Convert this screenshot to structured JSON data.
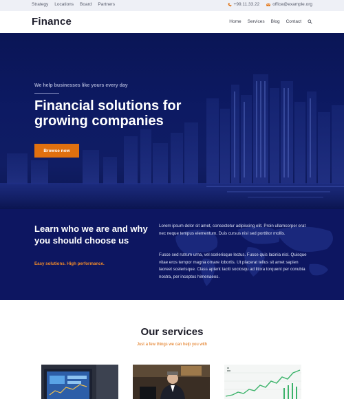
{
  "topbar": {
    "links": [
      "Strategy",
      "Locations",
      "Board",
      "Partners"
    ],
    "phone": "+99.11.33.22",
    "email": "office@example.org",
    "phone_icon": "phone-icon",
    "email_icon": "envelope-icon"
  },
  "header": {
    "logo": "Finance",
    "nav": [
      "Home",
      "Services",
      "Blog",
      "Contact"
    ],
    "search_icon": "search-icon"
  },
  "hero": {
    "eyebrow": "We help businesses like yours every day",
    "title": "Financial solutions for growing companies",
    "button": "Browse now"
  },
  "about": {
    "heading": "Learn who we are and why you should choose us",
    "tagline": "Easy solutions. High performance.",
    "paragraph1": "Lorem ipsum dolor sit amet, consectetur adipiscing elit. Proin ullamcorper erat nec neque tempus elementum. Duis cursus nisl sed porttitor mollis.",
    "paragraph2": "Fusce sed rutrum urna, vel scelerisque lectus. Fusce quis lacinia nisl. Quisque vitae eros tempor magna ornare lobortis. Ut placerat tellus sit amet sapien laoreet scelerisque. Class aptent taciti sociosqu ad litora torquent per conubia nostra, per inceptos himenaeos."
  },
  "services": {
    "title": "Our services",
    "subtitle": "Just a few things we can help you with"
  },
  "colors": {
    "accent": "#e0700f",
    "navy": "#0d1661"
  }
}
